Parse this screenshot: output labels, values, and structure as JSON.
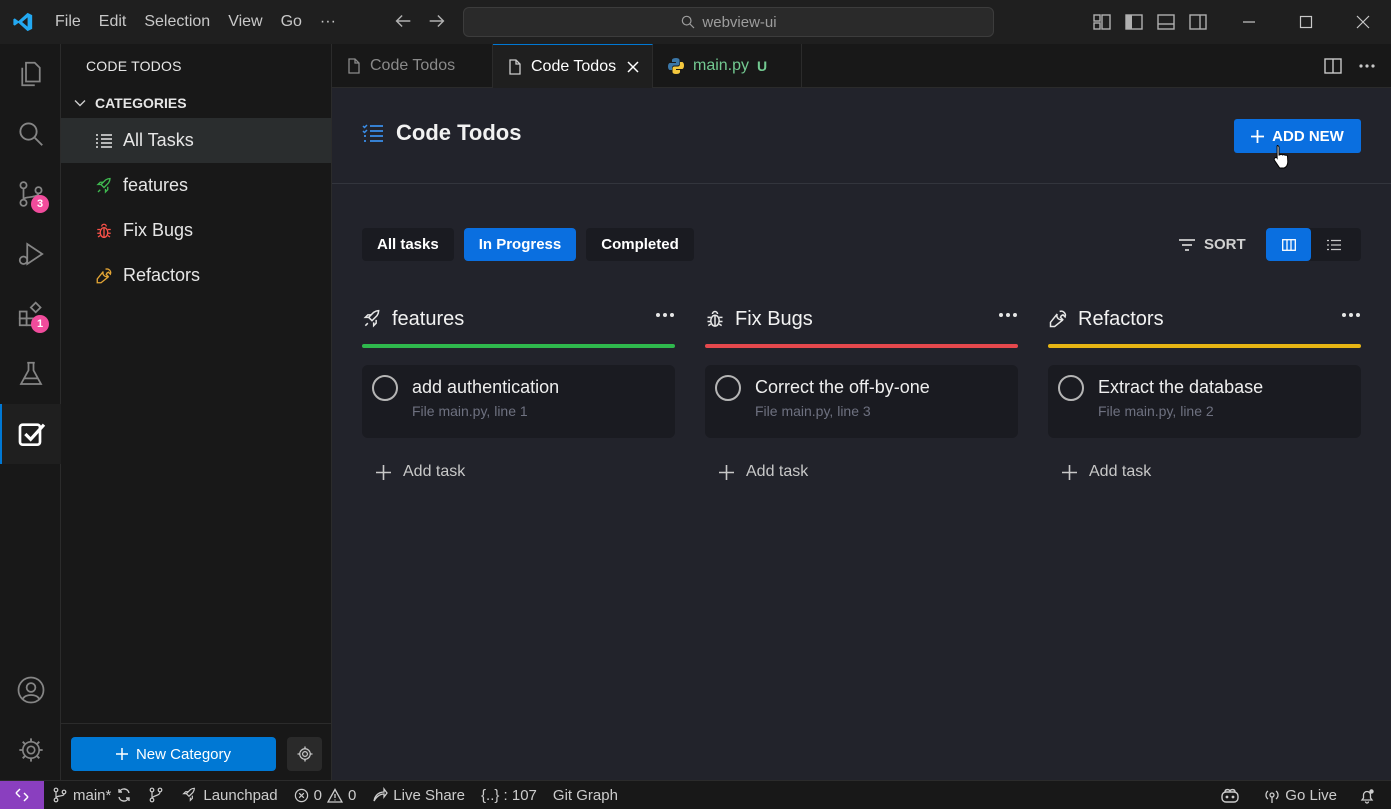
{
  "titlebar": {
    "menu": [
      "File",
      "Edit",
      "Selection",
      "View",
      "Go",
      "···"
    ],
    "search_text": "webview-ui"
  },
  "activity": {
    "source_control_badge": "3",
    "extensions_badge": "1"
  },
  "sidebar": {
    "title": "CODE TODOS",
    "section": "CATEGORIES",
    "items": [
      {
        "label": "All Tasks",
        "icon": "list-icon",
        "color": "#e6e6e6"
      },
      {
        "label": "features",
        "icon": "rocket-icon",
        "color": "#3fb950"
      },
      {
        "label": "Fix Bugs",
        "icon": "bug-icon",
        "color": "#f85149"
      },
      {
        "label": "Refactors",
        "icon": "wrench-icon",
        "color": "#e3a535"
      }
    ],
    "new_category_label": "New Category"
  },
  "tabs": [
    {
      "label": "Code Todos",
      "state": "inactive"
    },
    {
      "label": "Code Todos",
      "state": "active"
    },
    {
      "label": "main.py",
      "state": "inactive",
      "suffix": "U"
    }
  ],
  "main": {
    "title": "Code Todos",
    "add_new_label": "ADD NEW",
    "filters": [
      {
        "label": "All tasks",
        "active": false
      },
      {
        "label": "In Progress",
        "active": true
      },
      {
        "label": "Completed",
        "active": false
      }
    ],
    "sort_label": "SORT",
    "columns": [
      {
        "title": "features",
        "icon": "rocket-icon",
        "color": "#2fb84d",
        "task": {
          "title": "add authentication",
          "subtitle": "File main.py, line 1"
        },
        "add_label": "Add task"
      },
      {
        "title": "Fix Bugs",
        "icon": "bug-icon",
        "color": "#e5484d",
        "task": {
          "title": "Correct the off-by-one",
          "subtitle": "File main.py, line 3"
        },
        "add_label": "Add task"
      },
      {
        "title": "Refactors",
        "icon": "wrench-icon",
        "color": "#e6b514",
        "task": {
          "title": "Extract the database",
          "subtitle": "File main.py, line 2"
        },
        "add_label": "Add task"
      }
    ]
  },
  "statusbar": {
    "branch": "main*",
    "launchpad": "Launchpad",
    "errors": "0",
    "warnings": "0",
    "live_share": "Live Share",
    "json_count": "{..} : 107",
    "git_graph": "Git Graph",
    "go_live": "Go Live"
  },
  "colors": {
    "accent": "#0a6fe0",
    "vscode_blue": "#0078d4",
    "remote": "#8a3fbf",
    "badge": "#f14c9c"
  }
}
